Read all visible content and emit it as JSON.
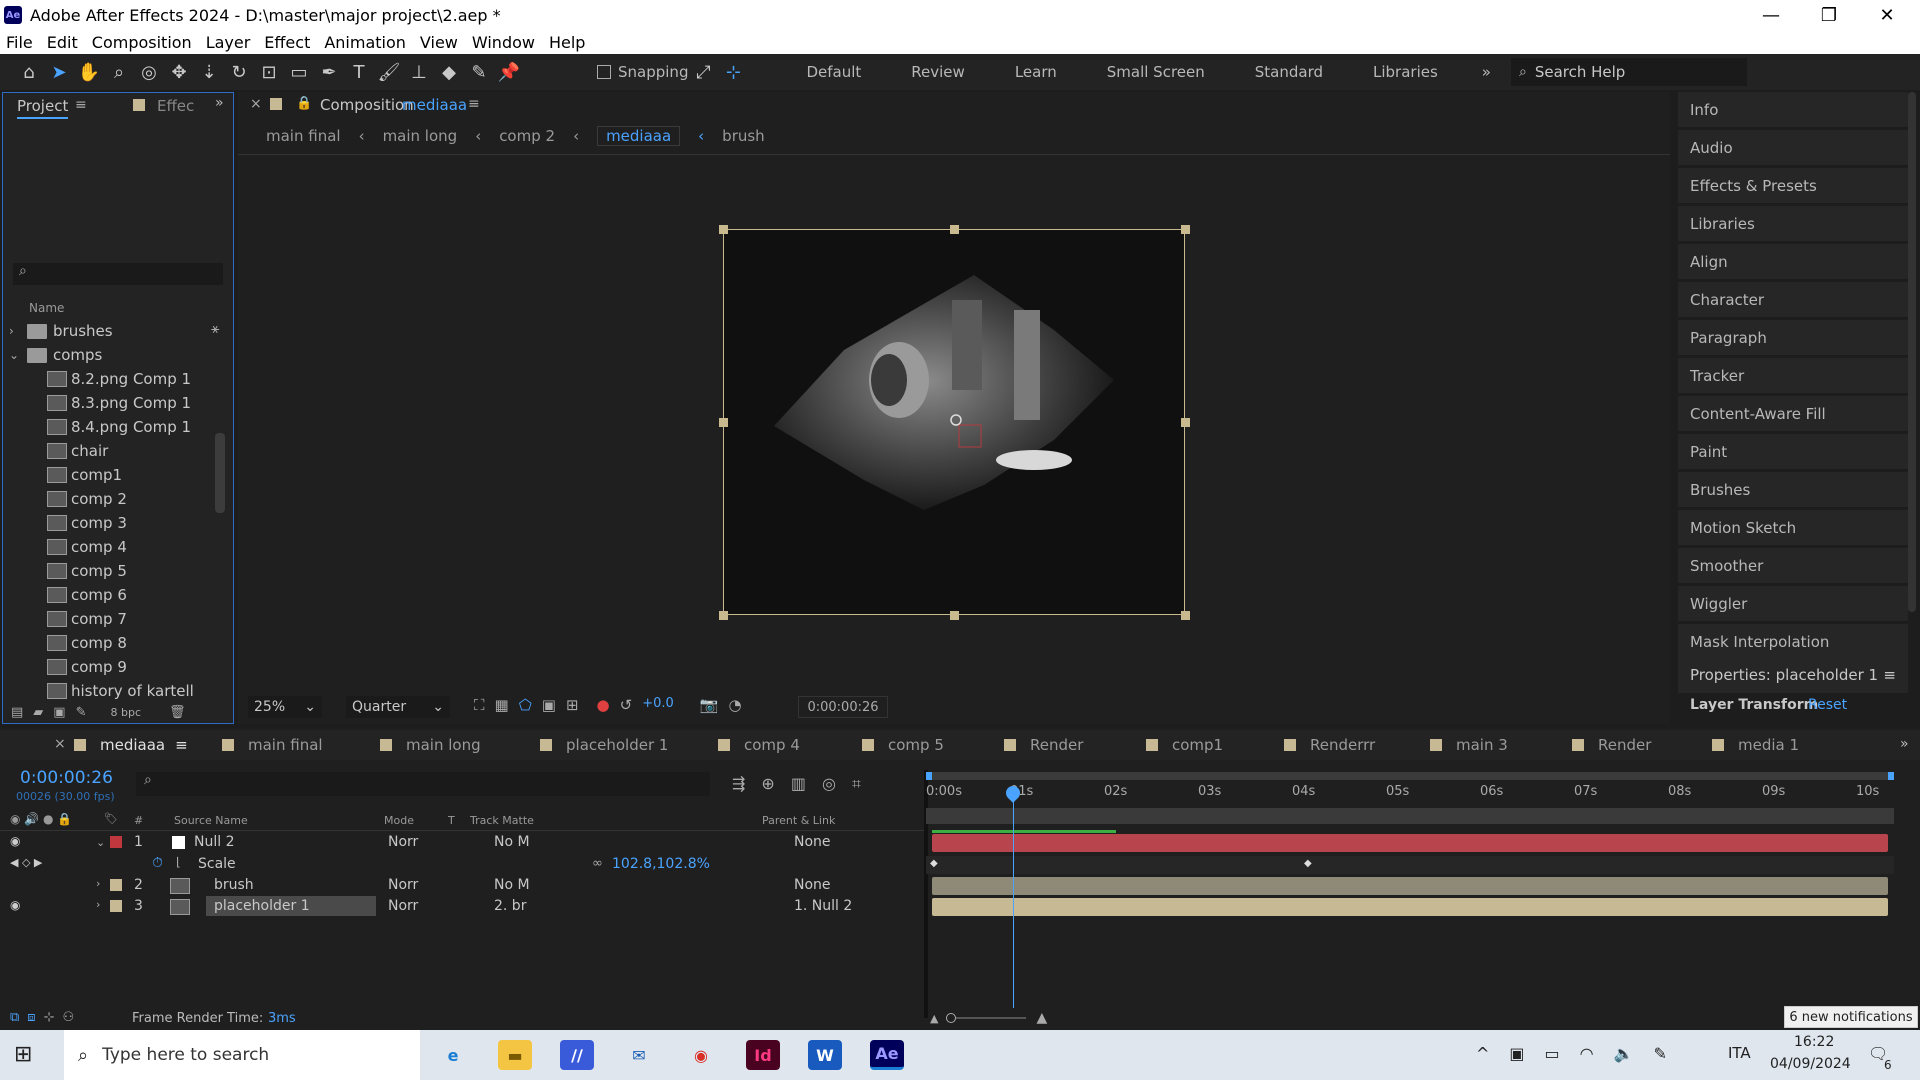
{
  "window": {
    "title": "Adobe After Effects 2024 - D:\\master\\major project\\2.aep *",
    "app_badge": "Ae",
    "controls": [
      "—",
      "❐",
      "✕"
    ]
  },
  "menu": [
    "File",
    "Edit",
    "Composition",
    "Layer",
    "Effect",
    "Animation",
    "View",
    "Window",
    "Help"
  ],
  "toolbar": {
    "snapping": "Snapping",
    "workspaces": [
      "Default",
      "Review",
      "Learn",
      "Small Screen",
      "Standard",
      "Libraries"
    ],
    "search_placeholder": "Search Help"
  },
  "project_panel": {
    "tab_project": "Project",
    "tab_effects": "Effec",
    "name_header": "Name",
    "bpc": "8 bpc",
    "items": [
      {
        "label": "brushes",
        "type": "folder"
      },
      {
        "label": "comps",
        "type": "folder"
      },
      {
        "label": "8.2.png Comp 1",
        "type": "comp"
      },
      {
        "label": "8.3.png Comp 1",
        "type": "comp"
      },
      {
        "label": "8.4.png Comp 1",
        "type": "comp"
      },
      {
        "label": "chair",
        "type": "comp"
      },
      {
        "label": "comp1",
        "type": "comp"
      },
      {
        "label": "comp 2",
        "type": "comp"
      },
      {
        "label": "comp 3",
        "type": "comp"
      },
      {
        "label": "comp 4",
        "type": "comp"
      },
      {
        "label": "comp 5",
        "type": "comp"
      },
      {
        "label": "comp 6",
        "type": "comp"
      },
      {
        "label": "comp 7",
        "type": "comp"
      },
      {
        "label": "comp 8",
        "type": "comp"
      },
      {
        "label": "comp 9",
        "type": "comp"
      },
      {
        "label": "history of kartell",
        "type": "comp"
      }
    ]
  },
  "composition_panel": {
    "title_prefix": "Composition",
    "title_name": "mediaaa",
    "breadcrumbs": [
      "main final",
      "main long",
      "comp 2",
      "mediaaa",
      "brush"
    ],
    "zoom": "25%",
    "resolution": "Quarter",
    "exposure": "+0.0",
    "timecode": "0:00:00:26"
  },
  "right_panel": {
    "items": [
      "Info",
      "Audio",
      "Effects & Presets",
      "Libraries",
      "Align",
      "Character",
      "Paragraph",
      "Tracker",
      "Content-Aware Fill",
      "Paint",
      "Brushes",
      "Motion Sketch",
      "Smoother",
      "Wiggler",
      "Mask Interpolation"
    ],
    "properties_title": "Properties: placeholder 1",
    "layer_transform": "Layer Transform",
    "reset": "Reset"
  },
  "timeline": {
    "tabs": [
      "mediaaa",
      "main final",
      "main long",
      "placeholder 1",
      "comp 4",
      "comp 5",
      "Render",
      "comp1",
      "Renderrr",
      "main 3",
      "Render",
      "media 1"
    ],
    "timecode": "0:00:00:26",
    "frame_info": "00026 (30.00 fps)",
    "headers": {
      "source_name": "Source Name",
      "mode": "Mode",
      "t": "T",
      "track_matte": "Track Matte",
      "parent": "Parent & Link"
    },
    "ticks": [
      "0:00s",
      "01s",
      "02s",
      "03s",
      "04s",
      "05s",
      "06s",
      "07s",
      "08s",
      "09s",
      "10s"
    ],
    "layers": [
      {
        "num": "1",
        "name": "Null 2",
        "mode": "Norr",
        "matte": "No M",
        "parent": "None",
        "color": "#c0383e"
      },
      {
        "num": "2",
        "name": "brush",
        "mode": "Norr",
        "matte": "No M",
        "parent": "None",
        "color": "#c7b993"
      },
      {
        "num": "3",
        "name": "placeholder 1",
        "mode": "Norr",
        "matte": "2. br",
        "parent": "1. Null 2",
        "color": "#c7b993"
      }
    ],
    "scale_label": "Scale",
    "scale_value": "102.8,102.8%",
    "frame_render_label": "Frame Render Time:",
    "frame_render_value": "3ms"
  },
  "notification": "6 new notifications",
  "taskbar": {
    "search_placeholder": "Type here to search",
    "lang": "ITA",
    "time": "16:22",
    "date": "04/09/2024",
    "badge": "6"
  }
}
